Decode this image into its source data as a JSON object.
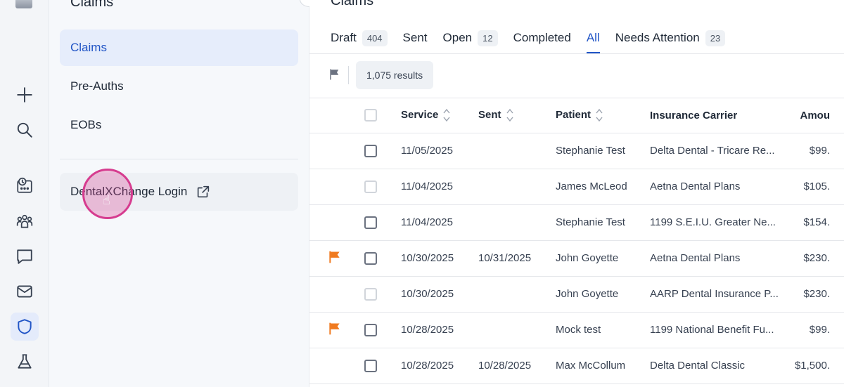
{
  "rail": {
    "items": [
      {
        "icon": "plus-icon"
      },
      {
        "icon": "search-icon"
      },
      {
        "icon": "schedule-icon"
      },
      {
        "icon": "people-icon"
      },
      {
        "icon": "chat-icon"
      },
      {
        "icon": "mail-icon"
      },
      {
        "icon": "shield-icon",
        "active": true
      },
      {
        "icon": "flask-icon"
      }
    ]
  },
  "subnav": {
    "title": "Claims",
    "items": [
      {
        "label": "Claims",
        "active": true
      },
      {
        "label": "Pre-Auths"
      },
      {
        "label": "EOBs"
      }
    ],
    "external_link": {
      "label": "DentalXChange Login",
      "icon": "external-link-icon"
    }
  },
  "main": {
    "title": "Claims",
    "tabs": [
      {
        "label": "Draft",
        "count": "404"
      },
      {
        "label": "Sent",
        "count": ""
      },
      {
        "label": "Open",
        "count": "12"
      },
      {
        "label": "Completed",
        "count": ""
      },
      {
        "label": "All",
        "count": "",
        "active": true
      },
      {
        "label": "Needs Attention",
        "count": "23"
      }
    ],
    "results_label": "1,075 results",
    "columns": [
      "Service",
      "Sent",
      "Patient",
      "Insurance Carrier",
      "Amou"
    ],
    "rows": [
      {
        "flagged": false,
        "checkbox_enabled": true,
        "service": "11/05/2025",
        "sent": "",
        "patient": "Stephanie Test",
        "carrier": "Delta Dental - Tricare Re...",
        "amount": "$99."
      },
      {
        "flagged": false,
        "checkbox_enabled": false,
        "service": "11/04/2025",
        "sent": "",
        "patient": "James McLeod",
        "carrier": "Aetna Dental Plans",
        "amount": "$105."
      },
      {
        "flagged": false,
        "checkbox_enabled": true,
        "service": "11/04/2025",
        "sent": "",
        "patient": "Stephanie Test",
        "carrier": "1199 S.E.I.U. Greater Ne...",
        "amount": "$154."
      },
      {
        "flagged": true,
        "checkbox_enabled": true,
        "service": "10/30/2025",
        "sent": "10/31/2025",
        "patient": "John Goyette",
        "carrier": "Aetna Dental Plans",
        "amount": "$230."
      },
      {
        "flagged": false,
        "checkbox_enabled": false,
        "service": "10/30/2025",
        "sent": "",
        "patient": "John Goyette",
        "carrier": "AARP Dental Insurance P...",
        "amount": "$230."
      },
      {
        "flagged": true,
        "checkbox_enabled": true,
        "service": "10/28/2025",
        "sent": "",
        "patient": "Mock test",
        "carrier": "1199 National Benefit Fu...",
        "amount": "$99."
      },
      {
        "flagged": false,
        "checkbox_enabled": true,
        "service": "10/28/2025",
        "sent": "10/28/2025",
        "patient": "Max McCollum",
        "carrier": "Delta Dental Classic",
        "amount": "$1,500."
      }
    ]
  },
  "colors": {
    "accent": "#2155c6",
    "flag": "#f07a1f",
    "cursor": "#d63c8f"
  }
}
